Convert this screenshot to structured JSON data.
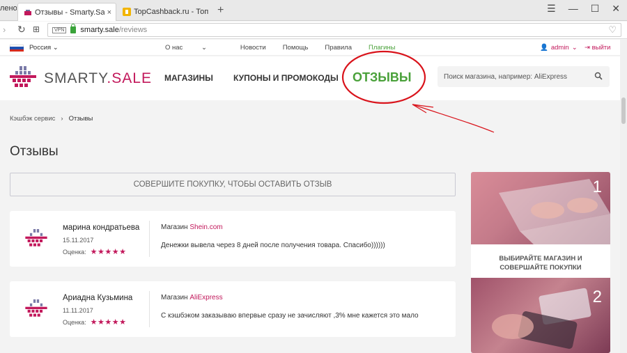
{
  "browser": {
    "prev_tab_fragment": "лено",
    "tabs": [
      {
        "title": "Отзывы - Smarty.Sale - Де",
        "active": true
      },
      {
        "title": "TopCashback.ru - Топ лучш",
        "active": false
      }
    ],
    "new_tab_symbol": "+",
    "url_host": "smarty.sale",
    "url_path": "/reviews",
    "vpn_label": "VPN"
  },
  "topbar": {
    "country": "Россия",
    "nav": [
      {
        "label": "О нас",
        "dropdown": true
      },
      {
        "label": "Новости"
      },
      {
        "label": "Помощь"
      },
      {
        "label": "Правила"
      },
      {
        "label": "Плагины",
        "highlight": true
      }
    ],
    "user": "admin",
    "exit": "выйти"
  },
  "header": {
    "logo_left": "SMARTY",
    "logo_dot": ".",
    "logo_right": "SALE",
    "menu": {
      "shops": "МАГАЗИНЫ",
      "coupons": "КУПОНЫ И ПРОМОКОДЫ",
      "reviews": "ОТЗЫВЫ"
    },
    "search_placeholder": "Поиск магазина, например: AliExpress"
  },
  "breadcrumb": {
    "root": "Кэшбэк сервис",
    "separator": "›",
    "current": "Отзывы"
  },
  "page_title": "Отзывы",
  "cta_label": "СОВЕРШИТЕ ПОКУПКУ, ЧТОБЫ ОСТАВИТЬ ОТЗЫВ",
  "reviews": [
    {
      "name": "марина кондратьева",
      "date": "15.11.2017",
      "rating_label": "Оценка:",
      "stars": "★★★★★",
      "shop_label": "Магазин",
      "shop": "Shein.com",
      "text": "Денежки вывела через 8 дней после получения товара. Спасибо))))))"
    },
    {
      "name": "Ариадна Кузьмина",
      "date": "11.11.2017",
      "rating_label": "Оценка:",
      "stars": "★★★★★",
      "shop_label": "Магазин",
      "shop": "AliExpress",
      "text": "С кэшбэком заказываю впервые сразу не зачисляют ,3% мне кажется это мало"
    }
  ],
  "sidebar": {
    "step1_number": "1",
    "step1_caption_line1": "ВЫБИРАЙТЕ МАГАЗИН И",
    "step1_caption_line2": "СОВЕРШАЙТЕ ПОКУПКИ",
    "step2_number": "2"
  },
  "colors": {
    "brand_pink": "#c2185b",
    "green": "#4aa13a",
    "annotation_red": "#d9131b"
  }
}
